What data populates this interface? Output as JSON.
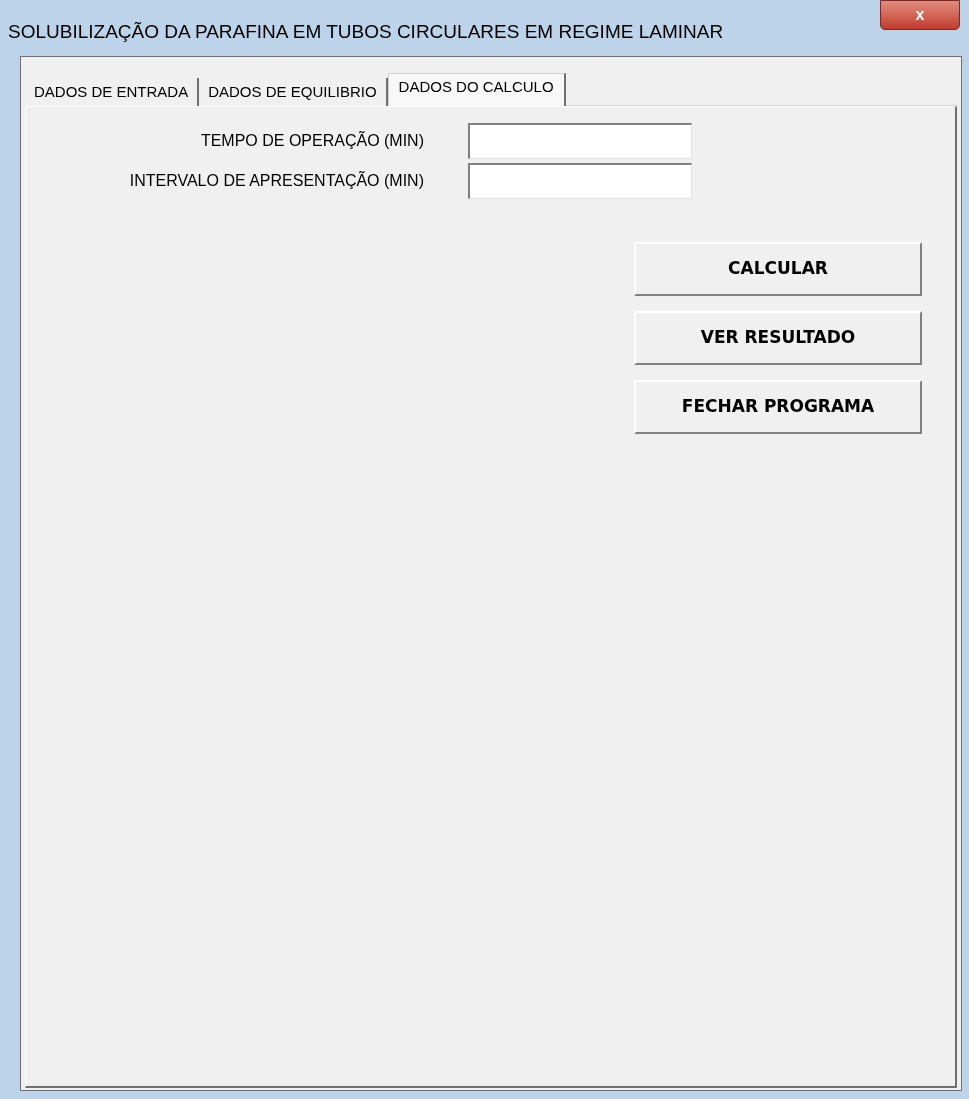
{
  "window": {
    "title": "SOLUBILIZAÇÃO DA PARAFINA EM TUBOS CIRCULARES EM REGIME LAMINAR",
    "close": "x"
  },
  "tabs": [
    {
      "label": "DADOS DE ENTRADA",
      "selected": false
    },
    {
      "label": "DADOS DE EQUILIBRIO",
      "selected": false
    },
    {
      "label": "DADOS DO CALCULO",
      "selected": true
    }
  ],
  "fields": [
    {
      "label": "TEMPO DE OPERAÇÃO (MIN)"
    },
    {
      "label": "INTERVALO DE APRESENTAÇÃO (MIN)"
    }
  ],
  "buttons": [
    "CALCULAR",
    "VER RESULTADO",
    "FECHAR PROGRAMA"
  ]
}
